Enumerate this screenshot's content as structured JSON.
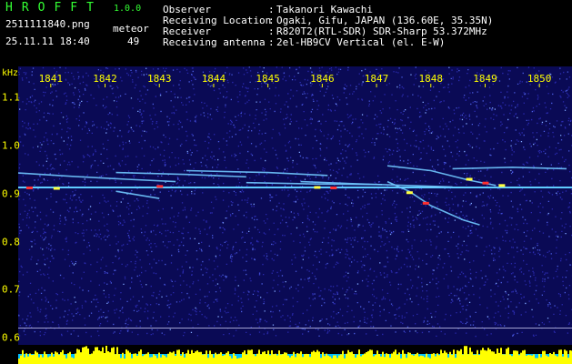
{
  "brand": {
    "name": "HROFFT",
    "version": "1.0.0"
  },
  "file": {
    "name": "2511111840.png",
    "datetime": "25.11.11 18:40",
    "meteor_label": "meteor",
    "meteor_count": "49"
  },
  "info": [
    {
      "label": "Observer",
      "sep": ":",
      "value": "Takanori Kawachi"
    },
    {
      "label": "Receiving Location",
      "sep": ":",
      "value": "Ogaki, Gifu, JAPAN (136.60E, 35.35N)"
    },
    {
      "label": "Receiver",
      "sep": ":",
      "value": "R820T2(RTL-SDR) SDR-Sharp 53.372MHz"
    },
    {
      "label": "Receiving antenna",
      "sep": ":",
      "value": "2el-HB9CV Vertical (el. E-W)"
    }
  ],
  "colors": {
    "background": "#000000",
    "header_text": "#ffffff",
    "axis_text": "#ffff00",
    "brand": "#33ff33",
    "noise": "#1a1a8a",
    "carrier": "#40c0ff",
    "meteor_hot": "#ff3030",
    "meteor_warm": "#ffff40",
    "power_bar": "#ffff00",
    "power_base": "#00c0ff"
  },
  "chart_data": {
    "type": "heatmap",
    "title": "",
    "xlabel": "",
    "ylabel": "kHz",
    "x_ticks": [
      "1841",
      "1842",
      "1843",
      "1844",
      "1845",
      "1846",
      "1847",
      "1848",
      "1849",
      "1850"
    ],
    "y_ticks": [
      "1.1",
      "1.0",
      "0.9",
      "0.8",
      "0.7",
      "0.6"
    ],
    "xlim": [
      "1840.4",
      "1850.6"
    ],
    "ylim": [
      0.585,
      1.165
    ],
    "carrier_khz": 0.913,
    "traces": [
      {
        "label": "",
        "points": [
          [
            1840.4,
            0.943
          ],
          [
            1841.4,
            0.936
          ],
          [
            1842.4,
            0.93
          ],
          [
            1843.3,
            0.925
          ]
        ]
      },
      {
        "label": "",
        "points": [
          [
            1842.2,
            0.944
          ],
          [
            1843.5,
            0.94
          ],
          [
            1844.6,
            0.935
          ]
        ]
      },
      {
        "label": "",
        "points": [
          [
            1843.5,
            0.948
          ],
          [
            1845.0,
            0.944
          ],
          [
            1846.1,
            0.938
          ]
        ]
      },
      {
        "label": "",
        "points": [
          [
            1844.6,
            0.923
          ],
          [
            1846.0,
            0.92
          ],
          [
            1847.1,
            0.919
          ]
        ]
      },
      {
        "label": "",
        "points": [
          [
            1845.6,
            0.925
          ],
          [
            1846.8,
            0.92
          ],
          [
            1848.4,
            0.914
          ]
        ]
      },
      {
        "label": "",
        "points": [
          [
            1847.2,
            0.925
          ],
          [
            1847.6,
            0.905
          ],
          [
            1848.0,
            0.875
          ],
          [
            1848.6,
            0.845
          ],
          [
            1848.9,
            0.835
          ]
        ]
      },
      {
        "label": "",
        "points": [
          [
            1847.2,
            0.958
          ],
          [
            1848.0,
            0.948
          ],
          [
            1848.7,
            0.928
          ],
          [
            1849.2,
            0.917
          ]
        ]
      },
      {
        "label": "",
        "points": [
          [
            1848.4,
            0.952
          ],
          [
            1849.5,
            0.955
          ],
          [
            1850.5,
            0.952
          ]
        ]
      },
      {
        "label": "",
        "points": [
          [
            1842.2,
            0.905
          ],
          [
            1843.0,
            0.89
          ]
        ]
      }
    ]
  }
}
